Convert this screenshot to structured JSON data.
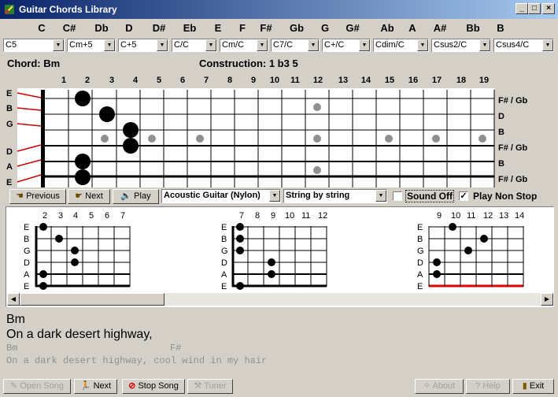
{
  "window": {
    "title": "Guitar Chords Library",
    "min": "_",
    "max": "□",
    "close": "×"
  },
  "keys": [
    "C",
    "C#",
    "Db",
    "D",
    "D#",
    "Eb",
    "E",
    "F",
    "F#",
    "Gb",
    "G",
    "G#",
    "Ab",
    "A",
    "A#",
    "Bb",
    "B"
  ],
  "chord_selects": [
    "C5",
    "Cm+5",
    "C+5",
    "C/C",
    "Cm/C",
    "C7/C",
    "C+/C",
    "Cdim/C",
    "Csus2/C",
    "Csus4/C"
  ],
  "chord_label": "Chord: Bm",
  "construction_label": "Construction: 1 b3 5",
  "fret_numbers": [
    "1",
    "2",
    "3",
    "4",
    "5",
    "6",
    "7",
    "8",
    "9",
    "10",
    "11",
    "12",
    "13",
    "14",
    "15",
    "16",
    "17",
    "18",
    "19"
  ],
  "left_strings": [
    "E",
    "B",
    "G",
    "",
    "D",
    "A",
    "E"
  ],
  "right_notes": [
    "F# / Gb",
    "D",
    "B",
    "F# / Gb",
    "B",
    "F# / Gb"
  ],
  "controls": {
    "previous": "Previous",
    "next": "Next",
    "play": "Play",
    "instrument": "Acoustic Guitar (Nylon)",
    "mode": "String by string",
    "sound_off": "Sound Off",
    "play_non_stop": "Play Non Stop"
  },
  "diagrams": [
    {
      "frets": [
        "2",
        "3",
        "4",
        "5",
        "6",
        "7"
      ],
      "strings": [
        "E",
        "B",
        "G",
        "D",
        "A",
        "E"
      ]
    },
    {
      "frets": [
        "7",
        "8",
        "9",
        "10",
        "11",
        "12"
      ],
      "strings": [
        "E",
        "B",
        "G",
        "D",
        "A",
        "E"
      ]
    },
    {
      "frets": [
        "9",
        "10",
        "11",
        "12",
        "13",
        "14"
      ],
      "strings": [
        "E",
        "B",
        "G",
        "D",
        "A",
        "E"
      ]
    }
  ],
  "lyrics": {
    "chord": "Bm",
    "line": "On a dark desert highway,",
    "chords_line_1": "Bm",
    "chords_line_2": "F#",
    "full_line": "On a dark desert highway, cool wind in my hair"
  },
  "bottom": {
    "open_song": "Open Song",
    "next": "Next",
    "stop_song": "Stop Song",
    "tuner": "Tuner",
    "about": "About",
    "help": "Help",
    "exit": "Exit"
  }
}
